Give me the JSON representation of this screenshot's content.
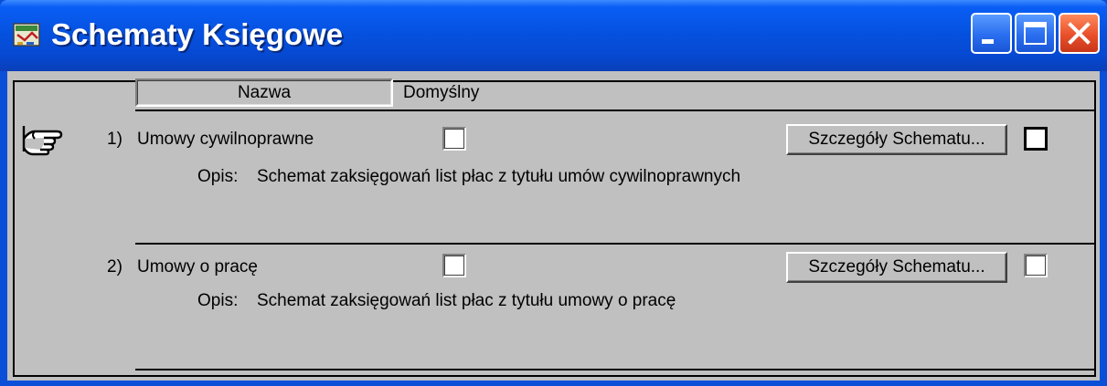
{
  "window": {
    "title": "Schematy Księgowe"
  },
  "header": {
    "col_name": "Nazwa",
    "col_default": "Domyślny"
  },
  "rows": [
    {
      "number": "1)",
      "name": "Umowy cywilnoprawne",
      "desc_label": "Opis:",
      "description": "Schemat zaksięgowań list płac z tytułu umów cywilnoprawnych",
      "details_button": "Szczegóły Schematu..."
    },
    {
      "number": "2)",
      "name": "Umowy o pracę",
      "desc_label": "Opis:",
      "description": "Schemat zaksięgowań list płac z tytułu umowy o pracę",
      "details_button": "Szczegóły Schematu..."
    }
  ],
  "icons": {
    "app": "ledger-app-icon",
    "current_row": "pointing-hand-icon"
  }
}
